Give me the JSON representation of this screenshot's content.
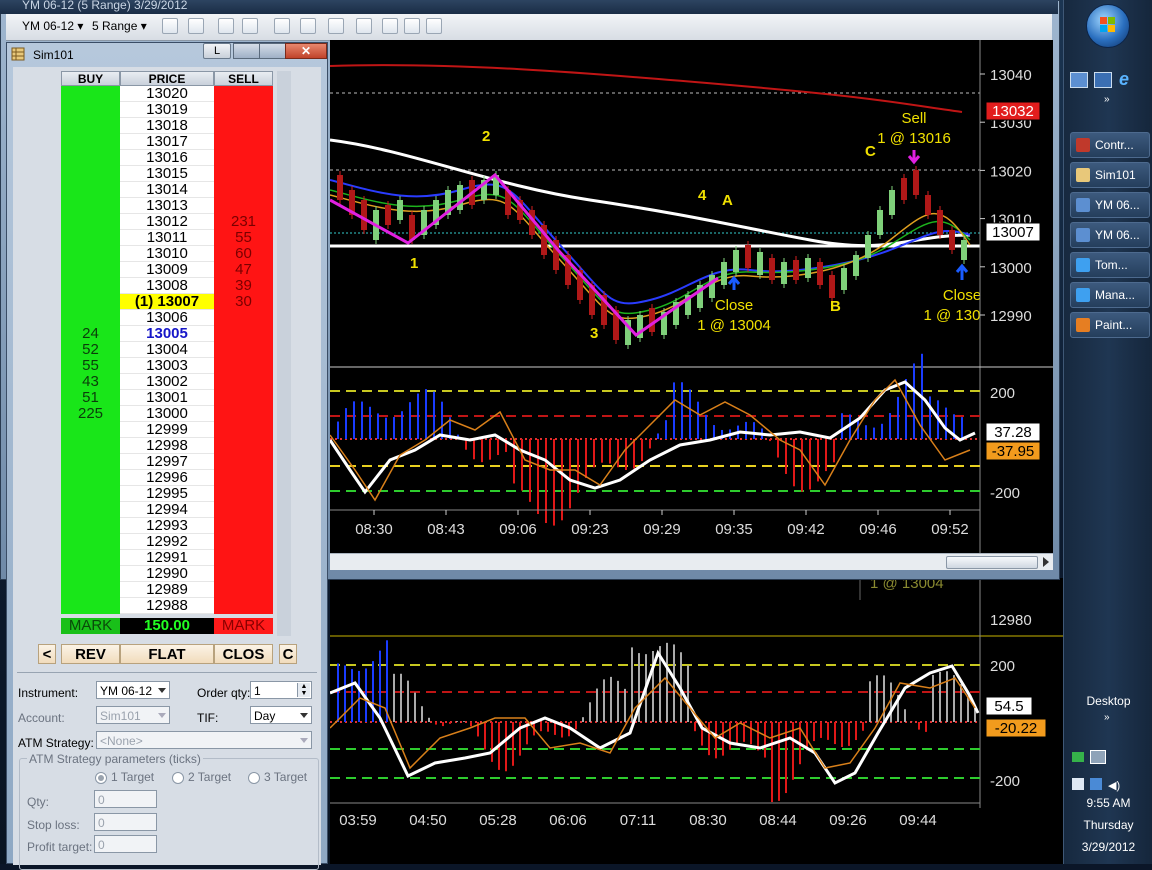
{
  "app": {
    "chart_title": "YM 06-12 (5 Range)  3/29/2012",
    "dom_title": "Sim101"
  },
  "toolbar": {
    "instrument": "YM 06-12",
    "period": "5 Range"
  },
  "dom": {
    "headers": {
      "buy": "BUY",
      "price": "PRICE",
      "sell": "SELL"
    },
    "title_button": "L",
    "rows": [
      {
        "price": "13020",
        "buy": "",
        "sell": ""
      },
      {
        "price": "13019",
        "buy": "",
        "sell": ""
      },
      {
        "price": "13018",
        "buy": "",
        "sell": ""
      },
      {
        "price": "13017",
        "buy": "",
        "sell": ""
      },
      {
        "price": "13016",
        "buy": "",
        "sell": ""
      },
      {
        "price": "13015",
        "buy": "",
        "sell": ""
      },
      {
        "price": "13014",
        "buy": "",
        "sell": ""
      },
      {
        "price": "13013",
        "buy": "",
        "sell": ""
      },
      {
        "price": "13012",
        "buy": "",
        "sell": "231"
      },
      {
        "price": "13011",
        "buy": "",
        "sell": "55"
      },
      {
        "price": "13010",
        "buy": "",
        "sell": "60"
      },
      {
        "price": "13009",
        "buy": "",
        "sell": "47"
      },
      {
        "price": "13008",
        "buy": "",
        "sell": "39"
      },
      {
        "price": "(1) 13007",
        "buy": "",
        "sell": "30"
      },
      {
        "price": "13006",
        "buy": "",
        "sell": ""
      },
      {
        "price": "13005",
        "buy": "24",
        "sell": ""
      },
      {
        "price": "13004",
        "buy": "52",
        "sell": ""
      },
      {
        "price": "13003",
        "buy": "55",
        "sell": ""
      },
      {
        "price": "13002",
        "buy": "43",
        "sell": ""
      },
      {
        "price": "13001",
        "buy": "51",
        "sell": ""
      },
      {
        "price": "13000",
        "buy": "225",
        "sell": ""
      },
      {
        "price": "12999",
        "buy": "",
        "sell": ""
      },
      {
        "price": "12998",
        "buy": "",
        "sell": ""
      },
      {
        "price": "12997",
        "buy": "",
        "sell": ""
      },
      {
        "price": "12996",
        "buy": "",
        "sell": ""
      },
      {
        "price": "12995",
        "buy": "",
        "sell": ""
      },
      {
        "price": "12994",
        "buy": "",
        "sell": ""
      },
      {
        "price": "12993",
        "buy": "",
        "sell": ""
      },
      {
        "price": "12992",
        "buy": "",
        "sell": ""
      },
      {
        "price": "12991",
        "buy": "",
        "sell": ""
      },
      {
        "price": "12990",
        "buy": "",
        "sell": ""
      },
      {
        "price": "12989",
        "buy": "",
        "sell": ""
      },
      {
        "price": "12988",
        "buy": "",
        "sell": ""
      }
    ],
    "position_row": "(1) 13007",
    "last_price_row": "13005",
    "mark_buy": "MARK",
    "mark_value": "150.00",
    "mark_sell": "MARK",
    "buttons": {
      "left": "<",
      "rev": "REV",
      "flat": "FLAT",
      "clos": "CLOS",
      "c": "C"
    },
    "form": {
      "instrument_label": "Instrument:",
      "instrument_value": "YM 06-12",
      "order_qty_label": "Order qty:",
      "order_qty_value": "1",
      "account_label": "Account:",
      "account_value": "Sim101",
      "tif_label": "TIF:",
      "tif_value": "Day",
      "atm_label": "ATM Strategy:",
      "atm_value": "<None>",
      "atm_params_label": "ATM Strategy parameters (ticks)",
      "targets": [
        "1 Target",
        "2 Target",
        "3 Target"
      ],
      "qty_label": "Qty:",
      "qty_value": "0",
      "stop_label": "Stop loss:",
      "stop_value": "0",
      "profit_label": "Profit target:",
      "profit_value": "0"
    }
  },
  "chart_data": [
    {
      "type": "line",
      "panel": "price",
      "y_ticks": [
        "13040",
        "13030",
        "13020",
        "13010",
        "13000",
        "12990"
      ],
      "x_ticks": [
        "08:30",
        "08:43",
        "09:06",
        "09:23",
        "09:29",
        "09:35",
        "09:42",
        "09:46",
        "09:52"
      ],
      "last_price_badge": "13032",
      "current_price_badge": "13007",
      "annotations": [
        "1",
        "2",
        "3",
        "4",
        "A",
        "B",
        "C",
        "Sell",
        "1 @ 13016",
        "Close",
        "1 @ 13004",
        "Close",
        "1 @ 130"
      ],
      "colors": {
        "up_bar": "#7fd07a",
        "down_bar": "#d22020",
        "zigzag": "#e020e0",
        "sma": "#ffffff",
        "long_ma": "#c01515"
      }
    },
    {
      "type": "line",
      "panel": "cci_top",
      "y_ticks": [
        "200",
        "-200"
      ],
      "value_badges": [
        "37.28",
        "-37.95"
      ]
    },
    {
      "type": "line",
      "panel": "cci_bottom",
      "price_tick": "12980",
      "y_ticks": [
        "200",
        "-200"
      ],
      "x_ticks": [
        "03:59",
        "04:50",
        "05:28",
        "06:06",
        "07:11",
        "08:30",
        "08:44",
        "09:26",
        "09:44"
      ],
      "value_badges": [
        "54.5",
        "-20.22"
      ],
      "ghost_text": "1 @ 13004"
    }
  ],
  "taskbar": {
    "items": [
      "Contr...",
      "Sim101",
      "YM 06...",
      "YM 06...",
      "Tom...",
      "Mana...",
      "Paint..."
    ],
    "desktop_label": "Desktop",
    "time": "9:55 AM",
    "day": "Thursday",
    "date": "3/29/2012"
  }
}
